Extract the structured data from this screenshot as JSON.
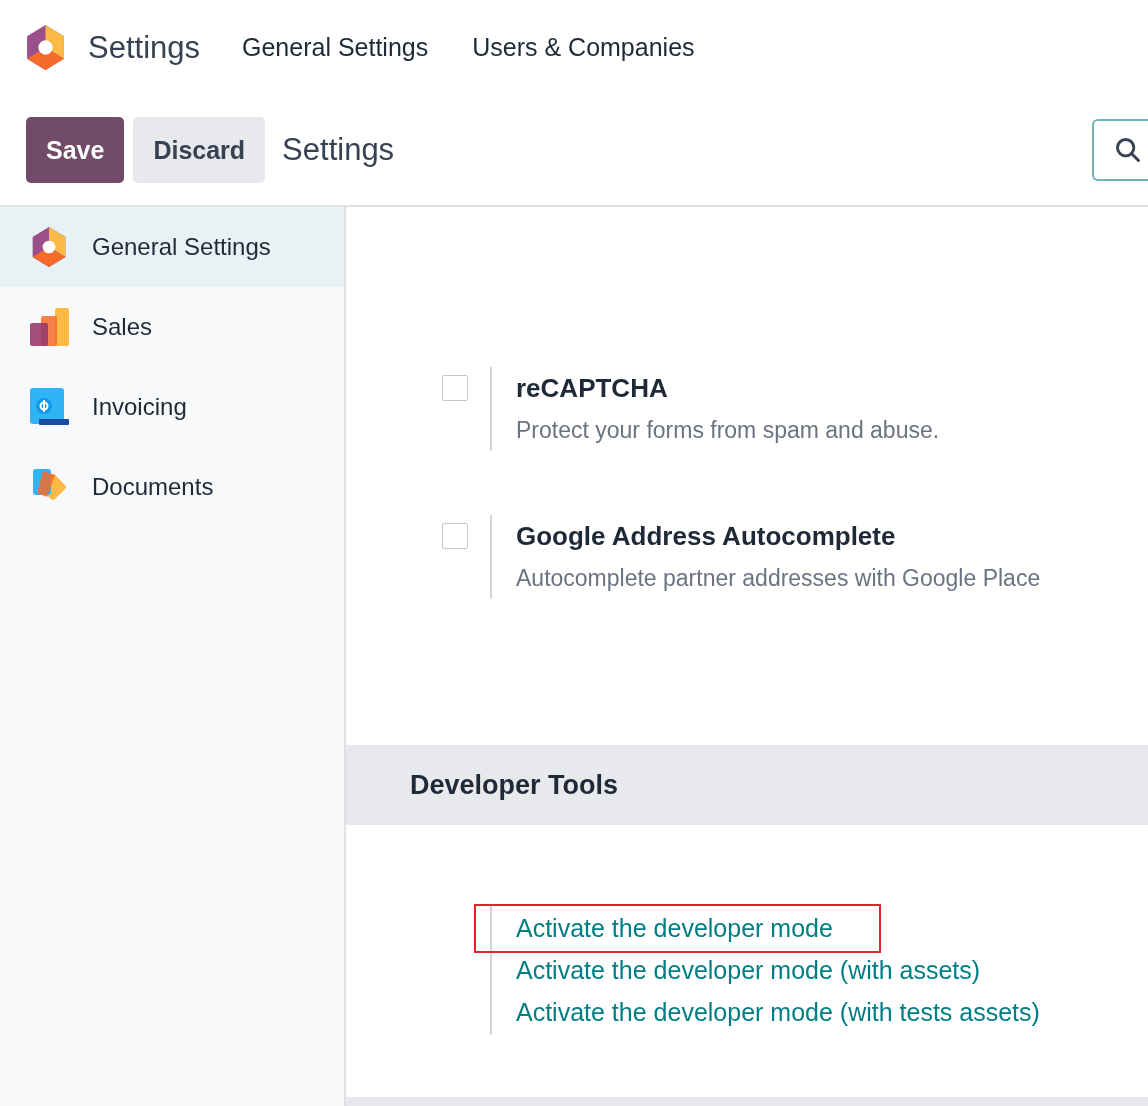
{
  "navbar": {
    "app_title": "Settings",
    "menu": [
      "General Settings",
      "Users & Companies"
    ]
  },
  "control_panel": {
    "save": "Save",
    "discard": "Discard",
    "breadcrumb": "Settings"
  },
  "sidebar": {
    "items": [
      {
        "label": "General Settings",
        "kind": "general",
        "selected": true
      },
      {
        "label": "Sales",
        "kind": "sales",
        "selected": false
      },
      {
        "label": "Invoicing",
        "kind": "invoicing",
        "selected": false
      },
      {
        "label": "Documents",
        "kind": "documents",
        "selected": false
      }
    ]
  },
  "settings": [
    {
      "title": "reCAPTCHA",
      "description": "Protect your forms from spam and abuse.",
      "checked": false
    },
    {
      "title": "Google Address Autocomplete",
      "description": "Autocomplete partner addresses with Google Place",
      "checked": false
    }
  ],
  "developer_tools": {
    "heading": "Developer Tools",
    "links": [
      {
        "label": "Activate the developer mode",
        "highlighted": true
      },
      {
        "label": "Activate the developer mode (with assets)",
        "highlighted": false
      },
      {
        "label": "Activate the developer mode (with tests assets)",
        "highlighted": false
      }
    ]
  }
}
